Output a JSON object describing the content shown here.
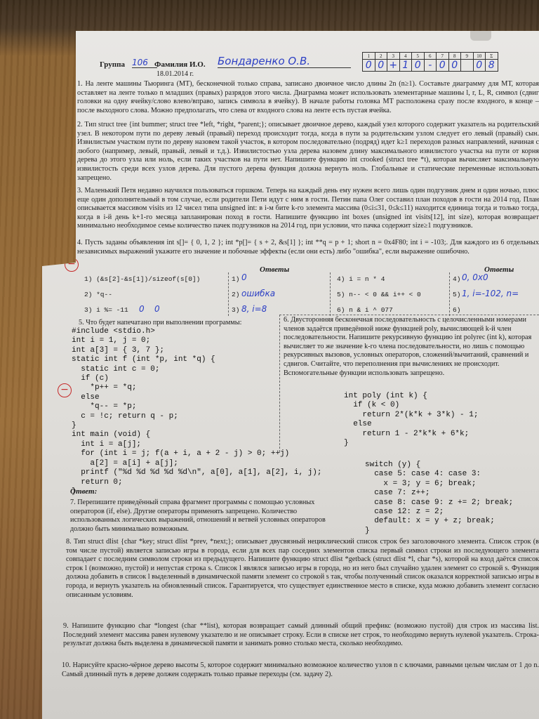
{
  "header": {
    "group_label": "Группа",
    "group_value": "106",
    "name_label": "Фамилия И.О.",
    "name_value": "Бондаренко О.В.",
    "date": "18.01.2014 г."
  },
  "grade_table": {
    "columns": [
      "1",
      "2",
      "3",
      "4",
      "5",
      "6",
      "7",
      "8",
      "9",
      "10",
      "Σ"
    ],
    "marks": [
      "0",
      "0",
      "+",
      "1",
      "0",
      "-",
      "0",
      "0",
      "",
      "0",
      "8"
    ]
  },
  "problems": {
    "p1": "1. На ленте машины Тьюринга (МТ), бесконечной только справа, записано двоичное число длины 2n (n≥1). Составьте диаграмму для МТ, которая оставляет на ленте только n младших (правых) разрядов этого числа. Диаграмма может использовать элементарные машины l, r, L, R, символ (сдвиг головки на одну ячейку/слово влево/вправо, запись символа в ячейку). В начале работы головка МТ расположена сразу после входного, в конце – после выходного слова. Можно предполагать, что слева от входного слова на ленте есть пустая ячейка.",
    "p2": "2. Тип struct tree {int bummer; struct tree *left, *right, *parent;}; описывает двоичное дерево, каждый узел которого содержит указатель на родительский узел. В некотором пути по дереву левый (правый) переход происходит тогда, когда в пути за родительским узлом следует его левый (правый) сын. Извилистым участком пути по дереву назовем такой участок, в котором последовательно (подряд) идет k≥1 переходов разных направлений, начиная с любого (например, левый, правый, левый и т.д.). Извилистостью узла дерева назовем длину максимального извилистого участка на пути от корня дерева до этого узла или ноль, если таких участков на пути нет. Напишите функцию int crooked (struct tree *t), которая вычисляет максимальную извилистость среди всех узлов дерева. Для пустого дерева функция должна вернуть ноль. Глобальные и статические переменные использовать запрещено.",
    "p3": "3. Маленький Петя недавно научился пользоваться горшком. Теперь на каждый день ему нужен всего лишь один подгузник днем и один ночью, плюс еще один дополнительный в том случае, если родители Пети идут с ним в гости. Петин папа Олег составил план походов в гости на 2014 год. План описывается массивом visits из 12 чисел типа unsigned int: в i-м бите k-го элемента массива (0≤i≤31, 0≤k≤11) находится единица тогда и только тогда, когда в i-й день k+1-го месяца запланирован поход в гости. Напишите функцию int boxes (unsigned int visits[12], int size), которая возвращает минимально необходимое семье количество пачек подгузников на 2014 год, при условии, что пачка содержит size≥1 подгузников.",
    "p4": "4. Пусть заданы объявления int s[]= { 0, 1, 2 }; int *p[]= { s + 2, &s[1] }; int **q = p + 1; short n = 0x4F80; int i = -103;. Для каждого из 6 отдельных независимых выражений укажите его значение и побочные эффекты (если они есть) либо \"ошибка\", если выражение ошибочно.",
    "p5": "5. Что будет напечатано при выполнении программы:",
    "p6": "6. Двусторонняя бесконечная последовательность с целочисленными номерами членов задаётся приведённой ниже функцией poly, вычисляющей k-й член последовательности. Напишите рекурсивную функцию int polyrec (int k), которая вычисляет то же значение k-го члена последовательности, но лишь с помощью рекурсивных вызовов, условных операторов, сложений/вычитаний, сравнений и сдвигов. Считайте, что переполнения при вычислениях не происходит. Вспомогательные функции использовать запрещено.",
    "p7": "7. Перепишите приведённый справа фрагмент программы с помощью условных операторов (if, else). Другие операторы применять запрещено. Количество использованных логических выражений, отношений и ветвей условных операторов должно быть минимально возможным.",
    "p8": "8. Тип struct dlist {char *key; struct dlist *prev, *next;}; описывает двусвязный нециклический список строк без заголовочного элемента. Список строк (в том числе пустой) является записью игры в города, если для всех пар соседних элементов списка первый символ строки из последующего элемента совпадает с последним символом строки из предыдущего. Напишите функцию struct dlist *getback (struct dlist *l, char *s), которой на вход даётся список строк l (возможно, пустой) и непустая строка s. Список l являлся записью игры в города, но из него был случайно удален элемент со строкой s. Функция должна добавить в список l выделенный в динамической памяти элемент со строкой s так, чтобы полученный список оказался корректной записью игры в города, и вернуть указатель на обновленный список. Гарантируется, что существует единственное место в списке, куда можно добавить элемент согласно описанным условиям.",
    "p9": "9. Напишите функцию char *longest (char **list), которая возвращает самый длинный общий префикс (возможно пустой) для строк из массива list. Последний элемент массива равен нулевому указателю и не описывает строку. Если в списке нет строк, то необходимо вернуть нулевой указатель. Строка-результат должна быть выделена в динамической памяти и занимать ровно столько места, сколько необходимо.",
    "p10": "10. Нарисуйте красно-чёрное дерево высоты 5, которое содержит минимально возможное количество узлов n с ключами, равными целым числам от 1 до n. Самый длинный путь в дереве должен содержать только правые переходы (см. задачу 2)."
  },
  "answers_table": {
    "heading_left": "Ответы",
    "heading_right": "Ответы",
    "left_exprs": [
      "1) (&s[2]-&s[1])/sizeof(s[0])",
      "2) *q--",
      "3) i %= -11"
    ],
    "left_answers": [
      "1) ",
      "2) ",
      "3) "
    ],
    "right_exprs": [
      "4) i = n * 4",
      "5) n-- < 0 && i++ < 0",
      "6) n & i ^ 077"
    ],
    "right_answers": [
      "4) ",
      "5) ",
      "6) "
    ],
    "hand_left": [
      "0",
      "ошибка",
      "8, i=8"
    ],
    "hand_right": [
      "0, 0x0",
      "1, i=-102, n=",
      ""
    ],
    "hand_side": [
      "0",
      "",
      "0"
    ]
  },
  "code5": "#include <stdio.h>\nint i = 1, j = 0;\nint a[3] = { 3, 7 };\nstatic int f (int *p, int *q) {\n  static int c = 0;\n  if (c)\n    *p++ = *q;\n  else\n    *q-- = *p;\n  c = !c; return q - p;\n}\nint main (void) {\n  int i = a[j];\n  for (int i = j; f(a + i, a + 2 - j) > 0; ++j)\n    a[2] = a[i] + a[j];\n  printf (\"%d %d %d %d %d\\n\", a[0], a[1], a[2], i, j);\n  return 0;\n}",
  "answer_label": "Ответ:",
  "code6": "int poly (int k) {\n  if (k < 0)\n    return 2*(k*k + 3*k) - 1;\n  else\n    return 1 - 2*k*k + 6*k;\n}",
  "code7": "switch (y) {\n  case 5: case 4: case 3:\n    x = 3; y = 6; break;\n  case 7: z++;\n  case 8: case 9: z += 2; break;\n  case 12: z = 2;\n  default: x = y + z; break;\n}",
  "marks": {
    "minus1": "−",
    "minus2": "−"
  }
}
